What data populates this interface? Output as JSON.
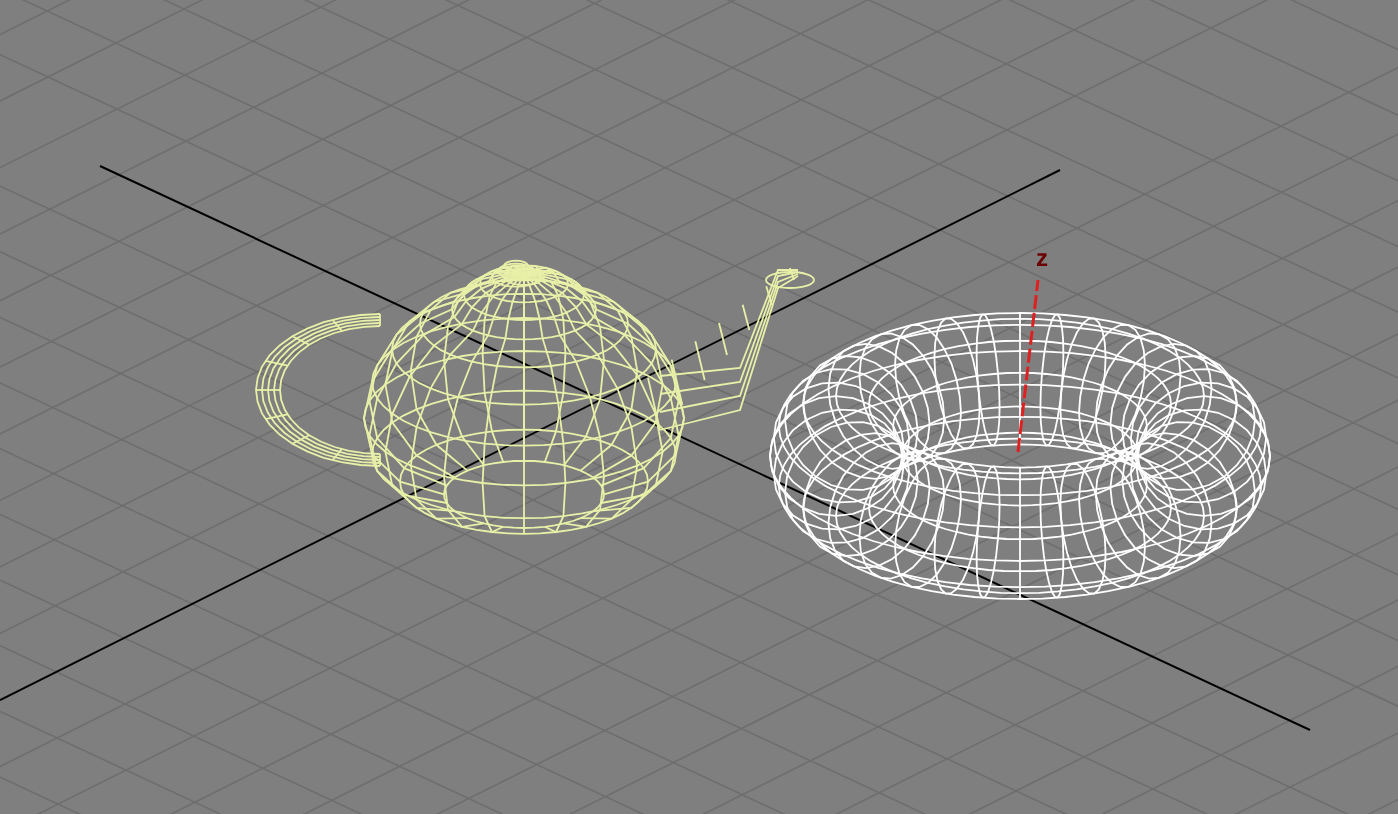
{
  "viewport": {
    "gizmo": {
      "axis_label": "z"
    }
  }
}
